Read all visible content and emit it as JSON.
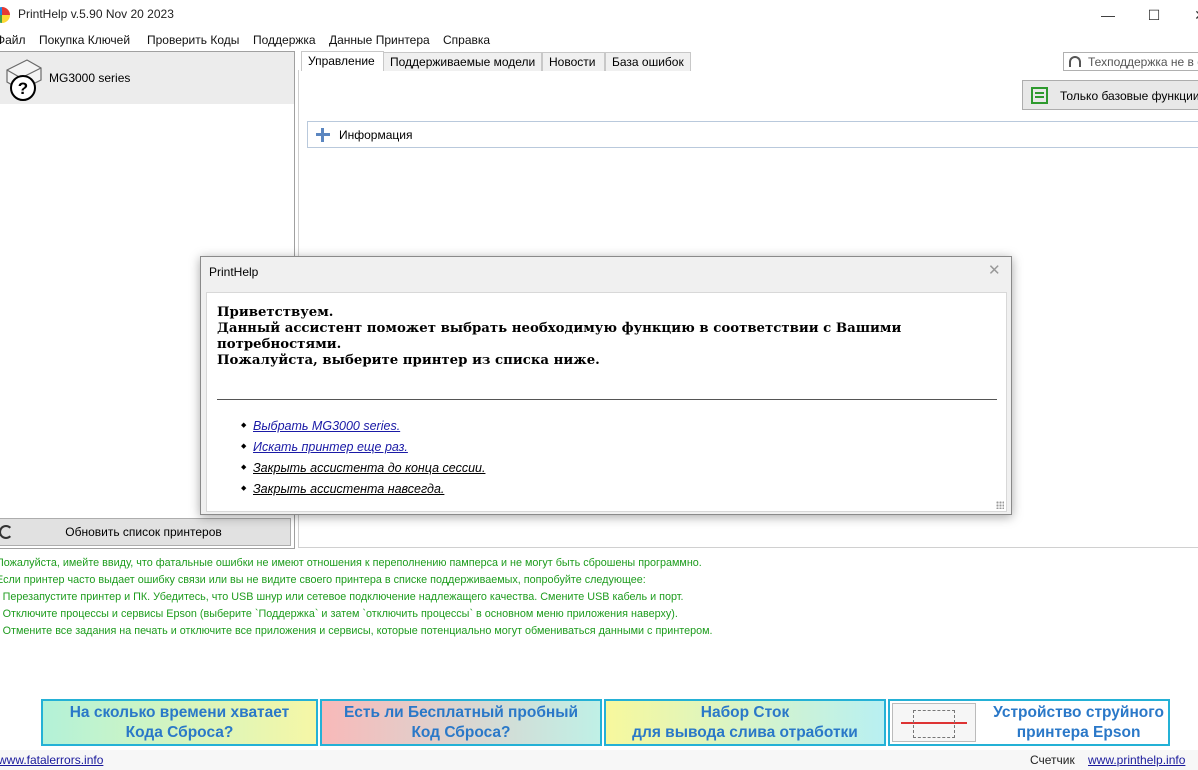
{
  "window": {
    "title": "PrintHelp v.5.90 Nov 20 2023",
    "minimize_icon": "—",
    "maximize_icon": "☐",
    "close_icon": "✕"
  },
  "menu": [
    "Файл",
    "Покупка Ключей",
    "Проверить Коды",
    "Поддержка",
    "Данные Принтера",
    "Справка"
  ],
  "printers": [
    {
      "name": "MG3000 series",
      "icon": "printer-unknown-icon"
    }
  ],
  "refresh_button": "Обновить список принтеров",
  "tabs": [
    "Управление",
    "Поддерживаемые модели",
    "Новости",
    "База ошибок"
  ],
  "active_tab": "Управление",
  "support_status": "Техподдержка не в сети",
  "basic_functions_button": "Только базовые функции",
  "info_section": "Информация",
  "dialog": {
    "title": "PrintHelp",
    "close_icon": "✕",
    "greeting_lines": [
      "Приветствуем.",
      "Данный ассистент поможет выбрать необходимую функцию в соответствии с Вашими",
      "потребностями.",
      "Пожалуйста, выберите принтер из списка ниже."
    ],
    "options": [
      "Выбрать MG3000 series.",
      "Искать принтер еще раз.",
      "Закрыть ассистента до конца сессии.",
      "Закрыть ассистента навсегда."
    ]
  },
  "notice_lines": [
    "Пожалуйста, имейте ввиду, что фатальные ошибки не имеют отношения к переполнению памперса и не могут быть сброшены программно.",
    "Если принтер часто выдает ошибку связи или вы не видите своего принтера в списке поддерживаемых, попробуйте следующее:",
    "- Перезапустите принтер и ПК. Убедитесь, что USB шнур или сетевое подключение надлежащего качества. Смените USB кабель и порт.",
    "- Отключите процессы и сервисы Epson (выберите `Поддержка` и затем `отключить процессы` в основном меню приложения наверху).",
    "- Отмените все задания на печать и отключите все приложения и сервисы, которые потенциально могут обмениваться данными с принтером."
  ],
  "banners": [
    {
      "line1": "На сколько времени хватает",
      "line2": "Кода Сброса?"
    },
    {
      "line1": "Есть ли Бесплатный пробный",
      "line2": "Код Сброса?"
    },
    {
      "line1": "Набор Сток",
      "line2": "для вывода слива отработки"
    },
    {
      "line1": "Устройство струйного",
      "line2": "принтера Epson"
    }
  ],
  "footer": {
    "left_link": "www.fatalerrors.info",
    "counter_label": "Счетчик",
    "right_link": "www.printhelp.info"
  },
  "colors": {
    "notice_text": "#1e9c1e",
    "banner_text": "#2a78c8",
    "banner_border": "#24b1d6",
    "link": "#1a1aa6"
  }
}
